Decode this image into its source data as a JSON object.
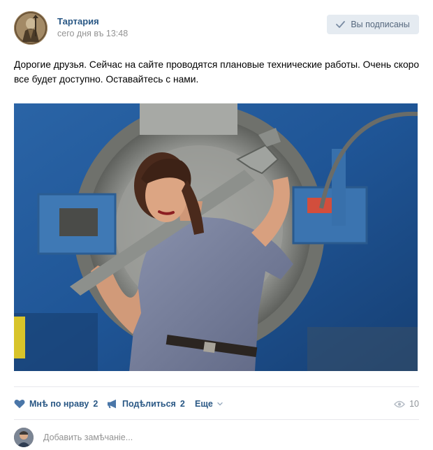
{
  "post": {
    "author": "Тартария",
    "date": "сего дня въ 13:48",
    "subscribe_label": "Вы подписаны",
    "text": "Дорогие друзья. Сейчас на сайте проводятся плановые технические работы. Очень скоро все будет доступно. Оставайтесь с нами."
  },
  "actions": {
    "like_label": "Мнѣ по нраву",
    "like_count": "2",
    "share_label": "Подѣлиться",
    "share_count": "2",
    "more_label": "Еще",
    "views_count": "10"
  },
  "comment": {
    "placeholder": "Добавить замѣчаніе..."
  },
  "colors": {
    "link": "#2a5885",
    "meta": "#939393",
    "button_bg": "#e5ebf1",
    "button_text": "#55677d",
    "views": "#909499"
  },
  "icons": {
    "check": "check-icon",
    "like": "heart-icon",
    "share": "megaphone-icon",
    "more": "chevron-down-icon",
    "views": "eye-icon"
  }
}
